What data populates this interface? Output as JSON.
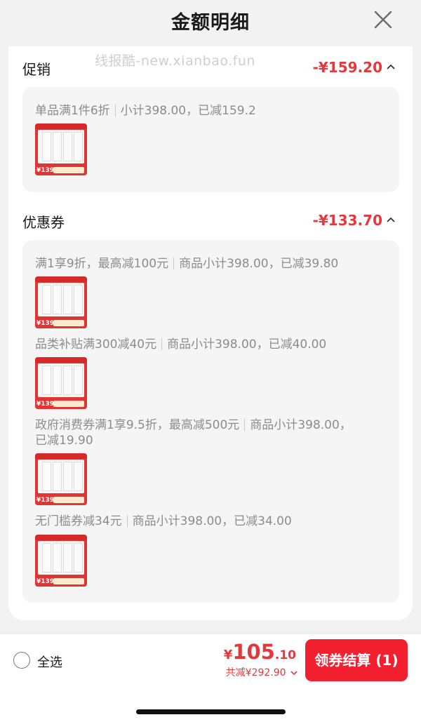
{
  "header": {
    "title": "金额明细",
    "close_icon": "close-icon"
  },
  "watermark": "线报酷-new.xianbao.fun",
  "promotion": {
    "title": "促销",
    "amount": "-¥159.20",
    "rule": "单品满1件6折",
    "detail": "小计398.00，已减159.2"
  },
  "coupons": {
    "title": "优惠券",
    "amount": "-¥133.70",
    "items": [
      {
        "rule": "满1享9折，最高减100元",
        "detail": "商品小计398.00，已减39.80"
      },
      {
        "rule": "品类补贴满300减40元",
        "detail": "商品小计398.00，已减40.00"
      },
      {
        "rule": "政府消费券满1享9.5折，最高减500元",
        "detail": "商品小计398.00，",
        "detail2": "已减19.90"
      },
      {
        "rule": "无门槛券减34元",
        "detail": "商品小计398.00，已减34.00"
      }
    ]
  },
  "product_thumb": {
    "price": "139",
    "brand": "许翠花"
  },
  "footer": {
    "select_all": "全选",
    "total_symbol": "¥",
    "total_int": "105",
    "total_dec": ".10",
    "saved": "共减¥292.90",
    "checkout": "领券结算 (1)"
  },
  "colors": {
    "accent": "#e4393c",
    "button": "#f2202f",
    "panel": "#f5f5f5"
  }
}
